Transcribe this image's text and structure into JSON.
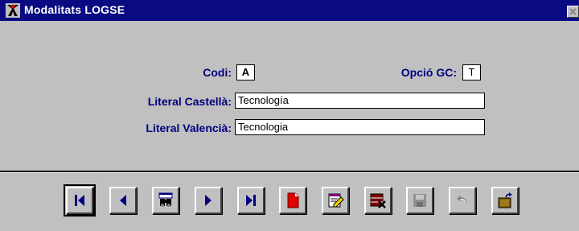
{
  "window": {
    "title": "Modalitats LOGSE",
    "icons": {
      "app": "app-icon",
      "close": "close-icon"
    }
  },
  "form": {
    "codi": {
      "label": "Codi:",
      "value": "A"
    },
    "opcio_gc": {
      "label": "Opció GC:",
      "value": "T"
    },
    "literal_castella": {
      "label": "Literal Castellà:",
      "value": "Tecnología"
    },
    "literal_valencia": {
      "label": "Literal Valencià:",
      "value": "Tecnologia"
    }
  },
  "toolbar": {
    "buttons": [
      {
        "name": "first-record-button",
        "icon": "first-record-icon",
        "enabled": true,
        "focused": true
      },
      {
        "name": "previous-record-button",
        "icon": "previous-icon",
        "enabled": true
      },
      {
        "name": "search-button",
        "icon": "search-binoculars-icon",
        "enabled": true
      },
      {
        "name": "next-record-button",
        "icon": "next-icon",
        "enabled": true
      },
      {
        "name": "last-record-button",
        "icon": "last-record-icon",
        "enabled": true
      },
      {
        "name": "new-record-button",
        "icon": "new-document-icon",
        "enabled": true
      },
      {
        "name": "edit-record-button",
        "icon": "edit-icon",
        "enabled": true
      },
      {
        "name": "delete-record-button",
        "icon": "delete-icon",
        "enabled": true
      },
      {
        "name": "save-button",
        "icon": "save-icon",
        "enabled": false
      },
      {
        "name": "undo-button",
        "icon": "undo-icon",
        "enabled": false
      },
      {
        "name": "exit-button",
        "icon": "exit-door-icon",
        "enabled": true
      }
    ]
  },
  "colors": {
    "titlebar": "#0a0a82",
    "label": "#000080",
    "background": "#c0c0c0",
    "nav_arrow": "#000080",
    "new_doc": "#e00000"
  }
}
